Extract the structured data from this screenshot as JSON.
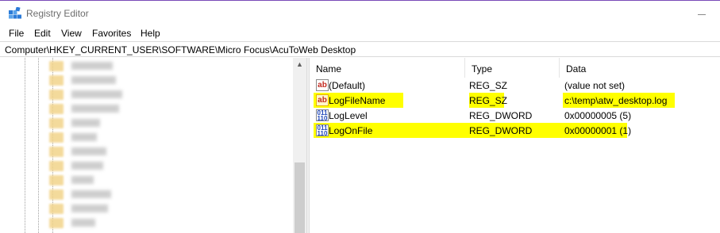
{
  "window": {
    "title": "Registry Editor"
  },
  "menu": [
    "File",
    "Edit",
    "View",
    "Favorites",
    "Help"
  ],
  "address": "Computer\\HKEY_CURRENT_USER\\SOFTWARE\\Micro Focus\\AcuToWeb Desktop",
  "columns": {
    "name": "Name",
    "type": "Type",
    "data": "Data"
  },
  "values": [
    {
      "name": "(Default)",
      "type": "REG_SZ",
      "data": "(value not set)",
      "icon": "string-value-icon",
      "highlighted": false
    },
    {
      "name": "LogFileName",
      "type": "REG_SZ",
      "data": "c:\\temp\\atw_desktop.log",
      "icon": "string-value-icon",
      "highlighted": true
    },
    {
      "name": "LogLevel",
      "type": "REG_DWORD",
      "data": "0x00000005 (5)",
      "icon": "dword-value-icon",
      "highlighted": false
    },
    {
      "name": "LogOnFile",
      "type": "REG_DWORD",
      "data": "0x00000001 (1)",
      "icon": "dword-value-icon",
      "highlighted": true
    }
  ],
  "colors": {
    "highlight": "#ffff00",
    "accent_line": "#7a4ab8"
  }
}
